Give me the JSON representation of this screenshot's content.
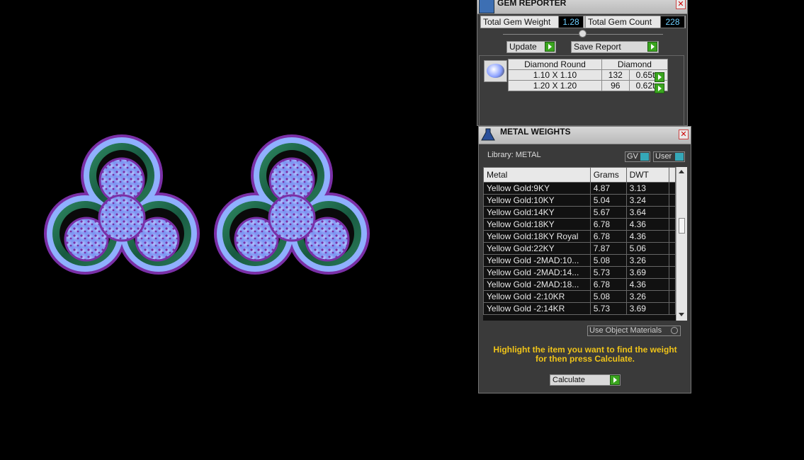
{
  "gem_reporter": {
    "title": "GEM REPORTER",
    "total_weight_label": "Total Gem Weight",
    "total_weight_value": "1.28",
    "total_count_label": "Total Gem Count",
    "total_count_value": "228",
    "update_label": "Update",
    "save_label": "Save Report",
    "table": {
      "header_shape": "Diamond Round",
      "header_material": "Diamond",
      "rows": [
        {
          "size": "1.10 X 1.10",
          "count": "132",
          "weight": "0.65tw"
        },
        {
          "size": "1.20 X 1.20",
          "count": "96",
          "weight": "0.62tw"
        }
      ]
    }
  },
  "metal_weights": {
    "title": "METAL WEIGHTS",
    "library_label": "Library: METAL",
    "gv_label": "GV",
    "user_label": "User",
    "columns": [
      "Metal",
      "Grams",
      "DWT"
    ],
    "rows": [
      {
        "metal": "Yellow Gold:9KY",
        "grams": "4.87",
        "dwt": "3.13"
      },
      {
        "metal": "Yellow Gold:10KY",
        "grams": "5.04",
        "dwt": "3.24"
      },
      {
        "metal": "Yellow Gold:14KY",
        "grams": "5.67",
        "dwt": "3.64"
      },
      {
        "metal": "Yellow Gold:18KY",
        "grams": "6.78",
        "dwt": "4.36"
      },
      {
        "metal": "Yellow Gold:18KY Royal",
        "grams": "6.78",
        "dwt": "4.36"
      },
      {
        "metal": "Yellow Gold:22KY",
        "grams": "7.87",
        "dwt": "5.06"
      },
      {
        "metal": "Yellow Gold -2MAD:10...",
        "grams": "5.08",
        "dwt": "3.26"
      },
      {
        "metal": "Yellow Gold -2MAD:14...",
        "grams": "5.73",
        "dwt": "3.69"
      },
      {
        "metal": "Yellow Gold -2MAD:18...",
        "grams": "6.78",
        "dwt": "4.36"
      },
      {
        "metal": "Yellow Gold -2:10KR",
        "grams": "5.08",
        "dwt": "3.26"
      },
      {
        "metal": "Yellow Gold -2:14KR",
        "grams": "5.73",
        "dwt": "3.69"
      }
    ],
    "use_object_materials_label": "Use Object Materials",
    "hint": "Highlight the item you want to find the weight for then press Calculate.",
    "calculate_label": "Calculate"
  },
  "colors": {
    "hint_text": "#f0c419",
    "accent_green": "#3aa51e",
    "metal_green": "#1f6b4e",
    "gem_blue": "#8fa8ff",
    "prong_purple": "#7a2fa6"
  }
}
